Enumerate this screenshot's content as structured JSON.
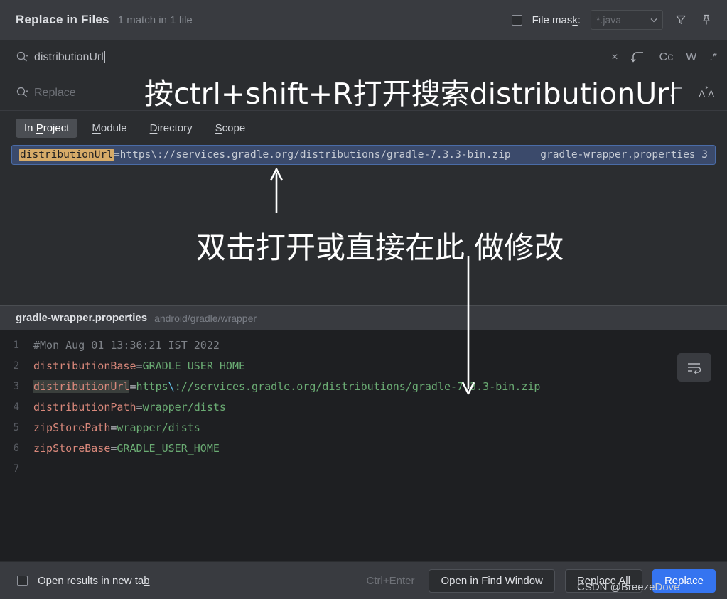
{
  "window": {
    "title": "Replace in Files",
    "match_summary": "1 match in 1 file",
    "file_mask_label": "File mask:",
    "file_mask_label_pre": "File mas",
    "file_mask_label_mnemonic": "k",
    "file_mask_label_post": ":",
    "file_mask_value": "*.java",
    "filter_icon": "filter-icon",
    "pin_icon": "pin-icon"
  },
  "search": {
    "value": "distributionUrl",
    "icon": "search-icon",
    "actions": [
      {
        "name": "clear-search-icon",
        "glyph": "×"
      },
      {
        "name": "search-history-icon",
        "glyph": "↶"
      },
      {
        "name": "match-case-toggle",
        "glyph": "Cc"
      },
      {
        "name": "whole-words-toggle",
        "glyph": "W"
      },
      {
        "name": "regex-toggle",
        "glyph": ".*"
      }
    ]
  },
  "replace": {
    "placeholder": "Replace",
    "icon": "search-icon",
    "actions": [
      {
        "name": "replace-history-icon",
        "glyph": "↶"
      },
      {
        "name": "preserve-case-toggle",
        "glyph": "ÁA"
      }
    ]
  },
  "scope_tabs": [
    {
      "label": "In Project",
      "pre": "In ",
      "mnemonic": "P",
      "post": "roject",
      "active": true
    },
    {
      "label": "Module",
      "pre": "",
      "mnemonic": "M",
      "post": "odule",
      "active": false
    },
    {
      "label": "Directory",
      "pre": "",
      "mnemonic": "D",
      "post": "irectory",
      "active": false
    },
    {
      "label": "Scope",
      "pre": "",
      "mnemonic": "S",
      "post": "cope",
      "active": false
    }
  ],
  "results": [
    {
      "match": "distributionUrl",
      "rest": "=https\\://services.gradle.org/distributions/gradle-7.3.3-bin.zip",
      "file": "gradle-wrapper.properties",
      "line": "3",
      "selected": true
    }
  ],
  "preview": {
    "file_name": "gradle-wrapper.properties",
    "file_path": "android/gradle/wrapper",
    "wrap_icon": "soft-wrap-icon",
    "lines": [
      {
        "num": "1",
        "type": "comment",
        "text": "#Mon Aug 01 13:36:21 IST 2022"
      },
      {
        "num": "2",
        "type": "pair",
        "key": "distributionBase",
        "value": "GRADLE_USER_HOME"
      },
      {
        "num": "3",
        "type": "pair-match",
        "key": "distributionUrl",
        "value": "https\\://services.gradle.org/distributions/gradle-7.3.3-bin.zip"
      },
      {
        "num": "4",
        "type": "pair",
        "key": "distributionPath",
        "value": "wrapper/dists"
      },
      {
        "num": "5",
        "type": "pair",
        "key": "zipStorePath",
        "value": "wrapper/dists"
      },
      {
        "num": "6",
        "type": "pair",
        "key": "zipStoreBase",
        "value": "GRADLE_USER_HOME"
      },
      {
        "num": "7",
        "type": "empty",
        "text": ""
      }
    ]
  },
  "bottom": {
    "open_new_tab_pre": "Open results in new ta",
    "open_new_tab_mnemonic": "b",
    "shortcut_hint": "Ctrl+Enter",
    "open_find_window": "Open in Find Window",
    "replace_all_pre": "Replace A",
    "replace_all_mnemonic": "ll",
    "replace": "Replace"
  },
  "annotations": {
    "top": "按ctrl+shift+R打开搜索distributionUrl",
    "middle": "双击打开或直接在此 做修改"
  },
  "watermark": "CSDN @BreezeDove",
  "colors": {
    "accent": "#3574f0",
    "match_highlight": "#d7ab68",
    "selection": "#3b4a6b"
  }
}
